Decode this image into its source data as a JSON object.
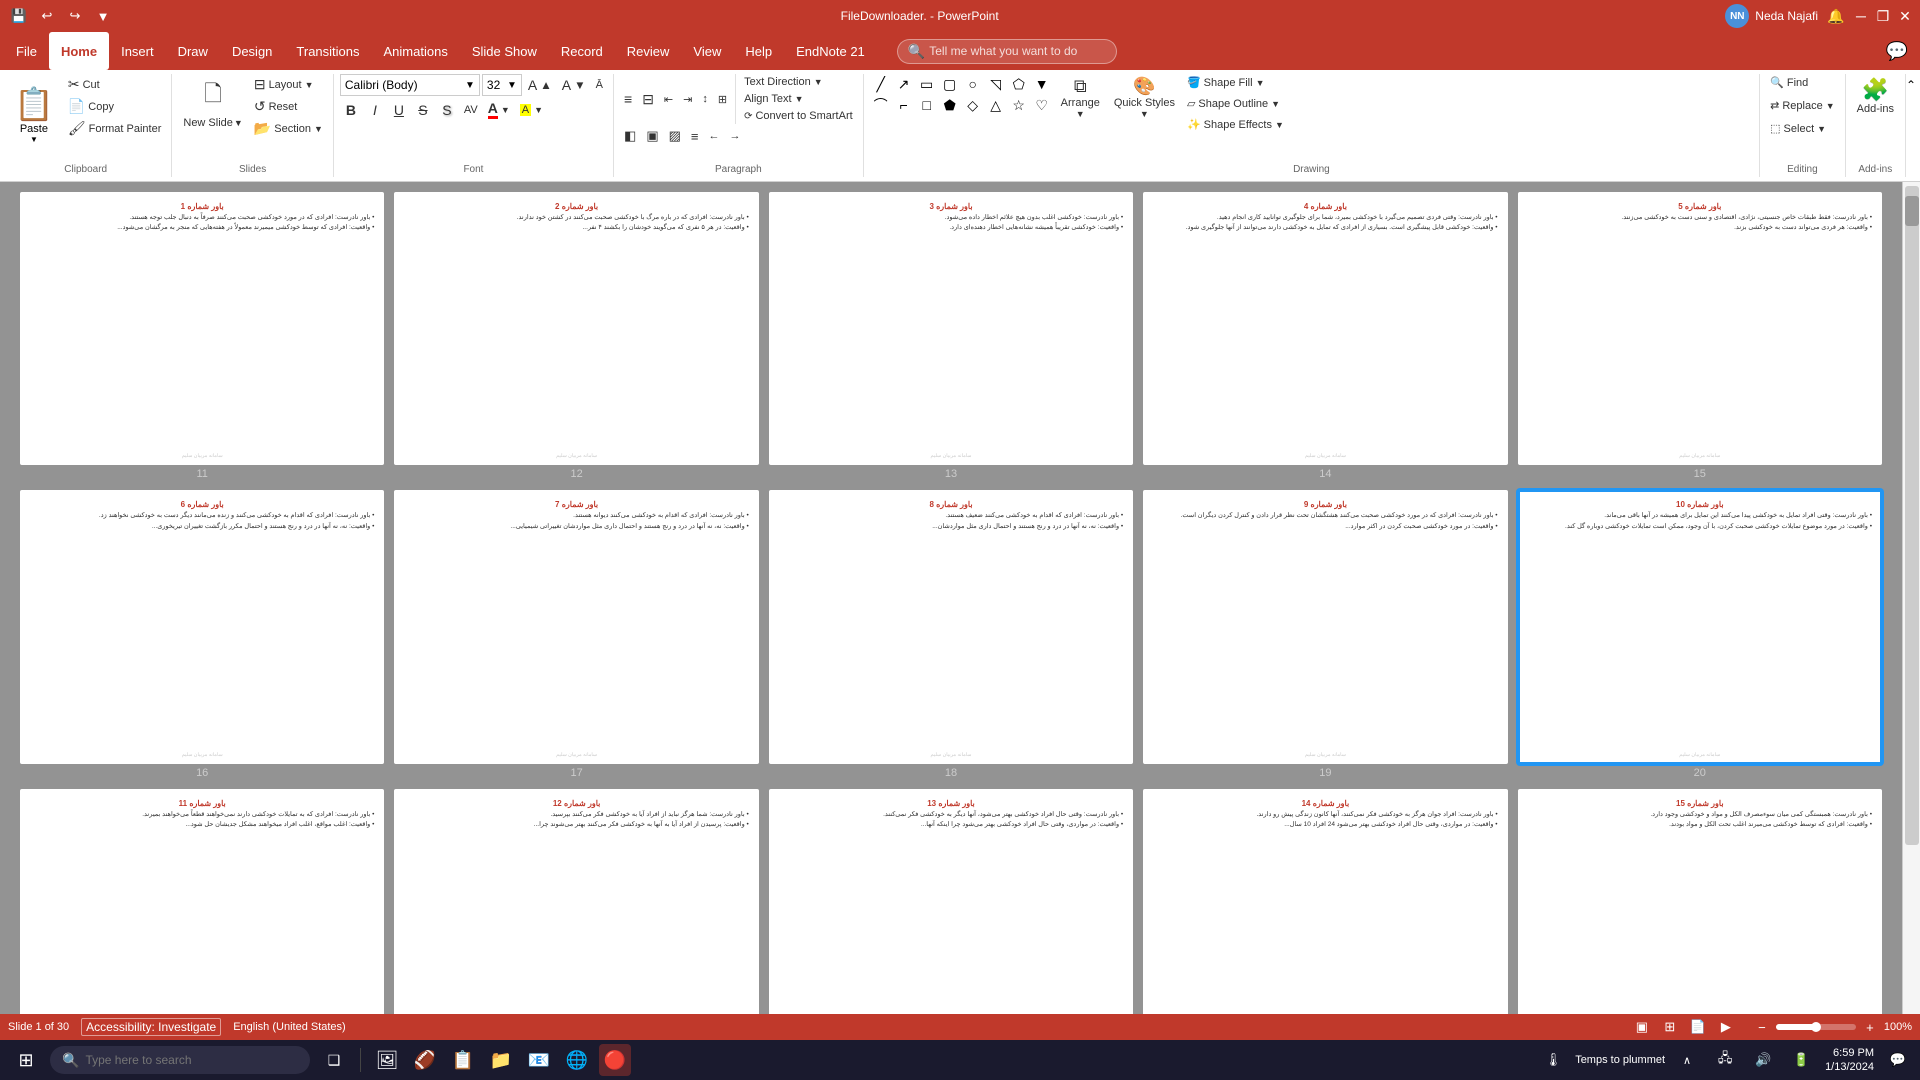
{
  "titlebar": {
    "filename": "FileDownloader. - PowerPoint",
    "user": "Neda Najafi",
    "minimize": "─",
    "restore": "❐",
    "close": "✕",
    "qat": [
      "💾",
      "↩",
      "↪",
      "🖫",
      "▼"
    ]
  },
  "menu": {
    "items": [
      "File",
      "Home",
      "Insert",
      "Draw",
      "Design",
      "Transitions",
      "Animations",
      "Slide Show",
      "Record",
      "Review",
      "View",
      "Help",
      "EndNote 21"
    ]
  },
  "ribbon": {
    "clipboard": {
      "label": "Clipboard",
      "paste_label": "Paste",
      "cut_label": "Cut",
      "copy_label": "Copy",
      "format_painter_label": "Format Painter"
    },
    "slides": {
      "label": "Slides",
      "new_slide_label": "New Slide",
      "layout_label": "Layout",
      "reset_label": "Reset",
      "section_label": "Section"
    },
    "font": {
      "label": "Font",
      "font_name": "Calibri (Body)",
      "font_size": "32",
      "bold": "B",
      "italic": "I",
      "underline": "U",
      "strikethrough": "S",
      "shadow": "S",
      "char_spacing": "AV",
      "increase_font": "A↑",
      "decrease_font": "A↓",
      "clear_format": "A",
      "font_color": "A"
    },
    "paragraph": {
      "label": "Paragraph",
      "bullets": "≡",
      "numbering": "≡",
      "decrease_indent": "⇤",
      "increase_indent": "⇥",
      "line_spacing": "↕",
      "columns": "⊞",
      "text_direction": "Text Direction",
      "align_text": "Align Text",
      "convert_smartart": "Convert to SmartArt",
      "align_left": "◧",
      "center": "▣",
      "align_right": "▨",
      "justify": "≡",
      "decrease_list": "←",
      "increase_list": "→"
    },
    "drawing": {
      "label": "Drawing",
      "arrange_label": "Arrange",
      "quick_styles_label": "Quick Styles",
      "shape_fill_label": "Shape Fill",
      "shape_outline_label": "Shape Outline",
      "shape_effects_label": "Shape Effects"
    },
    "editing": {
      "label": "Editing",
      "find_label": "Find",
      "replace_label": "Replace",
      "select_label": "Select"
    },
    "addins": {
      "label": "Add-ins",
      "addins_label": "Add-ins"
    },
    "tell_me": "Tell me what you want to do"
  },
  "slides": [
    {
      "num": 11,
      "title": "باور شماره 1",
      "text1": "باور نادرست: افرادی که در مورد خودکشی صحبت می‌کنند صرفاً به دنبال جلب توجه هستند.",
      "text2": "واقعیت: افرادی که توسط خودکشی میمیرند معمولاً در هفته‌هایی که منجر به مرگشان می‌شود...",
      "selected": false
    },
    {
      "num": 12,
      "title": "باور شماره 2",
      "text1": "باور نادرست: افرادی که در باره مرگ با خودکشی صحبت می‌کنند در کشتن خود ندارند.",
      "text2": "واقعیت: در هر ۵ نفری که می‌گویند خودشان را بکشند ۴ نفر...",
      "selected": false
    },
    {
      "num": 13,
      "title": "باور شماره 3",
      "text1": "باور نادرست: خودکشی اغلب بدون هیچ علائم اخطار داده می‌شود.",
      "text2": "واقعیت: خودکشی تقریباً همیشه نشانه‌هایی اخطار دهنده‌ای دارد.",
      "selected": false
    },
    {
      "num": 14,
      "title": "باور شماره 4",
      "text1": "باور نادرست: وقتی فردی تصمیم می‌گیرد با خودکشی بمیرد، شما برای جلوگیری توانایید کاری انجام دهید.",
      "text2": "واقعیت: خودکشی قابل پیشگیری است. بسیاری از افرادی که تمایل به خودکشی دارند می‌توانند از آنها جلوگیری شود.",
      "selected": false
    },
    {
      "num": 15,
      "title": "باور شماره 5",
      "text1": "باور نادرست: فقط طبقات خاص جنسیتی، نژادی، اقتصادی و سنی دست به خودکشی می‌زنند.",
      "text2": "واقعیت: هر فردی می‌تواند دست به خودکشی بزند.",
      "selected": false
    },
    {
      "num": 16,
      "title": "باور شماره 6",
      "text1": "باور نادرست: افرادی که اقدام به خودکشی می‌کنند و زنده می‌مانند دیگر دست به خودکشی نخواهند زد.",
      "text2": "واقعیت: نه، نه آنها در درد و رنج هستند و احتمال مکرر بازگشت تغییران تیریخوری...",
      "selected": false
    },
    {
      "num": 17,
      "title": "باور شماره 7",
      "text1": "باور نادرست: افرادی که اقدام به خودکشی می‌کنند دیوانه هستند.",
      "text2": "واقعیت: نه، نه آنها در درد و رنج هستند و احتمال داری مثل مواردشان تغییراتی شیمیایی...",
      "selected": false
    },
    {
      "num": 18,
      "title": "باور شماره 8",
      "text1": "باور نادرست: افرادی که اقدام به خودکشی می‌کنند ضعیف هستند.",
      "text2": "واقعیت: نه، نه آنها در درد و رنج هستند و احتمال داری مثل مواردشان...",
      "selected": false
    },
    {
      "num": 19,
      "title": "باور شماره 9",
      "text1": "باور نادرست: افرادی که در مورد خودکشی صحبت می‌کنند هشتگشان تحت نظر قرار دادن و کنترل کردن دیگران است.",
      "text2": "واقعیت: در مورد خودکشی صحبت کردن در اکثر موارد...",
      "selected": false
    },
    {
      "num": 20,
      "title": "باور شماره 10",
      "text1": "باور نادرست: وقتی افراد تمایل به خودکشی پیدا می‌کنند این تمایل برای همیشه در آنها باقی می‌ماند.",
      "text2": "واقعیت: در مورد موضوع تمایلات خودکشی صحبت کردن، با آن وجود، ممکن است تمایلات خودکشی دوباره گل کند.",
      "selected": true
    },
    {
      "num": 21,
      "title": "باور شماره 11",
      "text1": "باور نادرست: افرادی که به تمایلات خودکشی دارند نمی‌خواهند قطعاً می‌خواهند بمیرند.",
      "text2": "واقعیت: اغلب مواقع، اغلب افراد میخواهند مشکل جدیشان حل شود...",
      "selected": false
    },
    {
      "num": 22,
      "title": "باور شماره 12",
      "text1": "باور نادرست: شما هرگز نباید از افراد آیا به خودکشی فکر می‌کنند بپرسید.",
      "text2": "واقعیت: پرسیدن از افراد آیا به آنها به خودکشی فکر می‌کنند بهتر می‌شوند چرا...",
      "selected": false
    },
    {
      "num": 23,
      "title": "باور شماره 13",
      "text1": "باور نادرست: وقتی حال افراد خودکشی بهتر می‌شود، آنها دیگر به خودکشی فکر نمی‌کنند.",
      "text2": "واقعیت: در مواردی، وقتی حال افراد خودکشی بهتر می‌شود چرا اینکه آنها...",
      "selected": false
    },
    {
      "num": 24,
      "title": "باور شماره 14",
      "text1": "باور نادرست: افراد جوان هرگز به خودکشی فکر نمی‌کنند، آنها کانون زندگی پیش رو دارند.",
      "text2": "واقعیت: در مواردی، وقتی حال افراد خودکشی بهتر می‌شود 24 افراد 10 سال...",
      "selected": false
    },
    {
      "num": 25,
      "title": "باور شماره 15",
      "text1": "باور نادرست: همبستگی کمی میان سوء‌مصرف الکل و مواد و خودکشی وجود دارد.",
      "text2": "واقعیت: افرادی که توسط خودکشی می‌میرند اغلب تحت الکل و مواد بودند.",
      "selected": false
    }
  ],
  "statusbar": {
    "slide_info": "Slide 1 of 30",
    "language": "English (United States)",
    "accessibility": "Accessibility: Investigate",
    "zoom": "100%"
  },
  "taskbar": {
    "search_placeholder": "Type here to search",
    "time": "6:59 PM",
    "date": "1/13/2024",
    "start_icon": "⊞",
    "search_icon": "🔍",
    "task_view": "❑",
    "apps": [
      "🖼",
      "🏈",
      "📋",
      "🗂",
      "📧",
      "🌐",
      "🔴"
    ]
  }
}
